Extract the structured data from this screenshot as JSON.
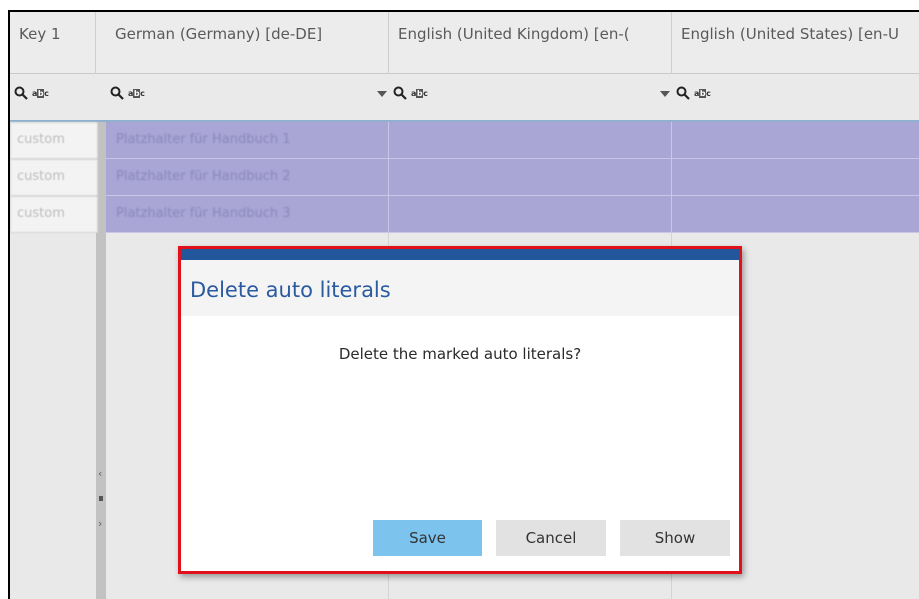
{
  "grid": {
    "columns": [
      {
        "header": "Key 1"
      },
      {
        "header": "German (Germany) [de-DE]"
      },
      {
        "header": "English (United Kingdom) [en-("
      },
      {
        "header": "English (United States) [en-U"
      }
    ],
    "filter": {
      "search_icon": "search-icon",
      "abc_icon": "text-filter-icon",
      "abc_text_left": "a",
      "abc_text_mid": "b",
      "abc_text_right": "c"
    },
    "rows": [
      {
        "key": "custom",
        "de": "Platzhalter für Handbuch 1"
      },
      {
        "key": "custom",
        "de": "Platzhalter für Handbuch 2"
      },
      {
        "key": "custom",
        "de": "Platzhalter für Handbuch 3"
      }
    ],
    "scroll_left_glyph": "‹",
    "scroll_right_glyph": "›"
  },
  "dialog": {
    "title": "Delete auto literals",
    "message": "Delete the marked auto literals?",
    "buttons": {
      "save": "Save",
      "cancel": "Cancel",
      "show": "Show"
    }
  },
  "colors": {
    "highlight": "#e0111b",
    "dialog_accent": "#23579c",
    "selected_row": "#a9a6d6",
    "primary_button": "#7cc3ee"
  }
}
